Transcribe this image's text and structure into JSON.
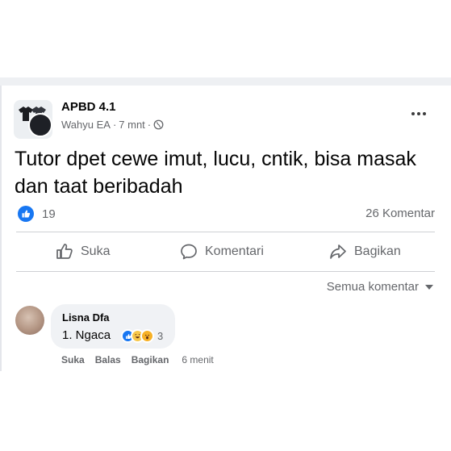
{
  "post": {
    "group_name": "APBD 4.1",
    "author": "Wahyu EA",
    "time": "7 mnt",
    "separator": "·",
    "text": "Tutor dpet cewe imut, lucu, cntik, bisa masak dan taat beribadah",
    "reaction_count": "19",
    "comment_count": "26 Komentar"
  },
  "actions": {
    "like": "Suka",
    "comment": "Komentari",
    "share": "Bagikan"
  },
  "comments_filter": "Semua komentar",
  "comment": {
    "author": "Lisna Dfa",
    "text": "1. Ngaca",
    "reaction_count": "3",
    "actions": {
      "like": "Suka",
      "reply": "Balas",
      "share": "Bagikan",
      "time": "6 menit"
    }
  },
  "colors": {
    "facebook_blue": "#1877f2",
    "secondary_text": "#65676b",
    "comment_bubble": "#f0f2f5",
    "divider": "#ced0d4"
  },
  "icons": [
    "group-avatar",
    "user-avatar",
    "globe-icon",
    "more-icon",
    "like-reaction-icon",
    "thumbs-up-icon",
    "comment-icon",
    "share-icon",
    "caret-down-icon",
    "haha-reaction-icon",
    "wow-reaction-icon"
  ]
}
